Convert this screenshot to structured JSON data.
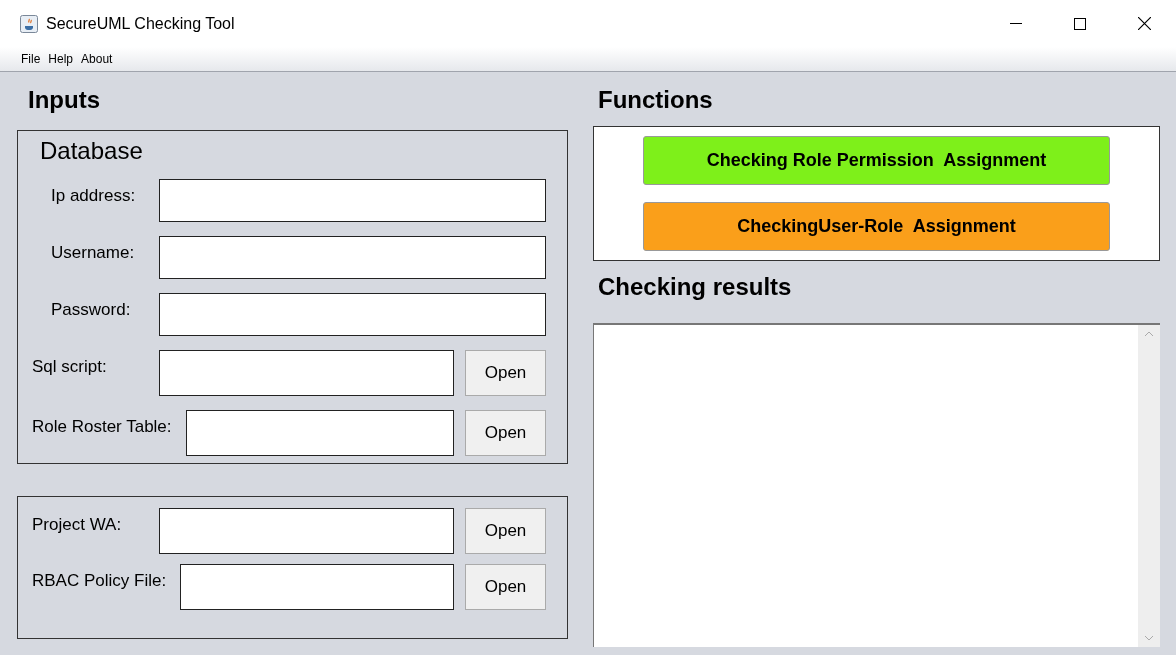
{
  "window": {
    "title": "SecureUML Checking Tool"
  },
  "menu": [
    "File",
    "Help",
    "About"
  ],
  "inputs": {
    "heading": "Inputs",
    "database": {
      "title": "Database",
      "rows": [
        {
          "kind": "text",
          "label": "Ip address:"
        },
        {
          "kind": "text",
          "label": "Username:"
        },
        {
          "kind": "text",
          "label": "Password:"
        },
        {
          "kind": "file",
          "label": "Sql script:",
          "button": "Open"
        },
        {
          "kind": "file",
          "label": "Role Roster Table:",
          "button": "Open"
        }
      ]
    },
    "project": {
      "rows": [
        {
          "kind": "file",
          "label": "Project WA:",
          "button": "Open"
        },
        {
          "kind": "file",
          "label": "RBAC Policy File:",
          "button": "Open"
        }
      ]
    }
  },
  "functions": {
    "heading": "Functions",
    "buttons": [
      {
        "label": "Checking Role Permission  Assignment",
        "color": "#7ef01a"
      },
      {
        "label": "CheckingUser-Role  Assignment",
        "color": "#fa9f1a"
      }
    ]
  },
  "results": {
    "heading": "Checking results"
  }
}
